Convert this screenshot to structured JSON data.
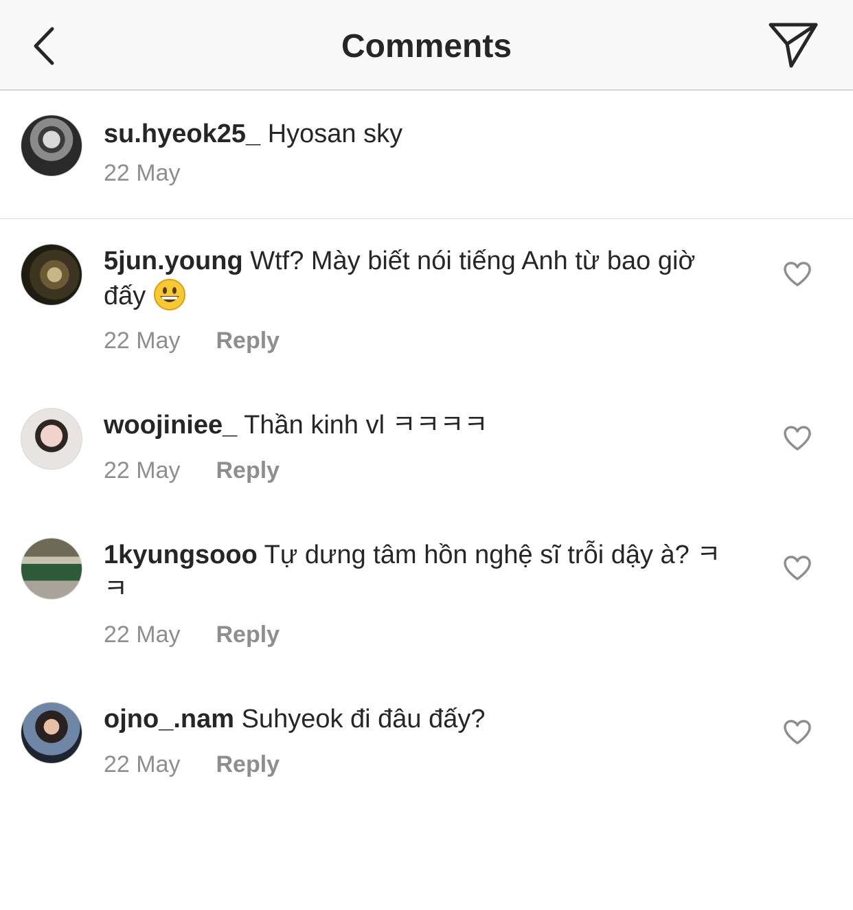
{
  "header": {
    "title": "Comments",
    "back_icon": "chevron-left-icon",
    "send_icon": "paper-plane-icon"
  },
  "caption": {
    "username": "su.hyeok25_",
    "text": " Hyosan sky",
    "date": "22 May"
  },
  "comments": [
    {
      "username": "5jun.young",
      "text": " Wtf? Mày biết nói tiếng Anh từ bao giờ đấy ",
      "emoji": "grinning-face-emoji",
      "date": "22 May",
      "reply_label": "Reply"
    },
    {
      "username": "woojiniee_",
      "text": " Thần kinh vl ㅋㅋㅋㅋ",
      "date": "22 May",
      "reply_label": "Reply"
    },
    {
      "username": "1kyungsooo",
      "text": " Tự dưng tâm hồn nghệ sĩ trỗi dậy à? ㅋㅋ",
      "date": "22 May",
      "reply_label": "Reply"
    },
    {
      "username": "ojno_.nam",
      "text": " Suhyeok đi đâu đấy?",
      "date": "22 May",
      "reply_label": "Reply"
    }
  ],
  "colors": {
    "text": "#262626",
    "secondary": "#8e8e8e",
    "header_bg": "#f9f9f9"
  }
}
